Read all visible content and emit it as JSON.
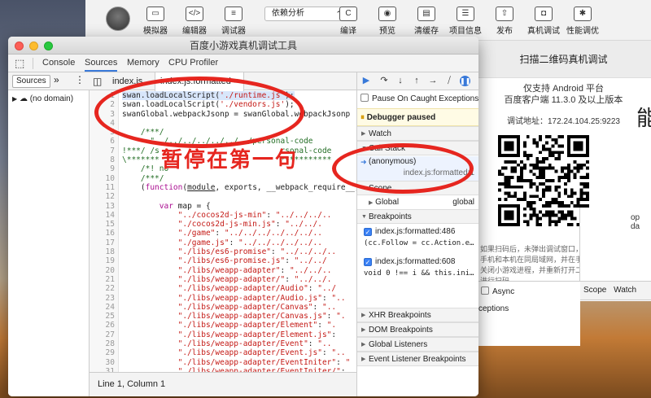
{
  "ide": {
    "toolbar": [
      {
        "label": "模拟器",
        "icon": "▭"
      },
      {
        "label": "编辑器",
        "icon": "</>"
      },
      {
        "label": "调试器",
        "icon": "≡"
      },
      {
        "label": "编译",
        "icon": "C"
      },
      {
        "label": "预览",
        "icon": "◉"
      },
      {
        "label": "清缓存",
        "icon": "▤"
      },
      {
        "label": "项目信息",
        "icon": "☰"
      },
      {
        "label": "发布",
        "icon": "⇧"
      },
      {
        "label": "真机调试",
        "icon": "◘"
      },
      {
        "label": "性能调优",
        "icon": "✱"
      }
    ],
    "mode_select": "依赖分析"
  },
  "qr_panel": {
    "title": "扫描二维码真机调试",
    "support_line1": "仅支持 Android 平台",
    "support_line2": "百度客户端 11.3.0 及以上版本",
    "address": "调试地址：172.24.104.25:9223",
    "note": "如果扫码后，未弹出调试窗口，请保证手机和本机在同局域网，并在手机上，关闭小游戏进程，并重新打开二维码，进行扫码。",
    "side_text": "能"
  },
  "background": {
    "op_text": "op da",
    "async_label": "Async",
    "exceptions_label": "xceptions",
    "scope_tab": "Scope",
    "watch_tab": "Watch"
  },
  "devtools": {
    "title": "百度小游戏真机调试工具",
    "panel_tabs": [
      "Console",
      "Sources",
      "Memory",
      "CPU Profiler"
    ],
    "active_panel": "Sources",
    "navigator": {
      "tab": "Sources",
      "tree_item": "(no domain)"
    },
    "editor": {
      "tabs": [
        {
          "label": "index.js"
        },
        {
          "label": "index.js:formatted",
          "close": "×"
        }
      ],
      "status": "Line 1, Column 1"
    },
    "debugger": {
      "pause_on_caught": "Pause On Caught Exceptions",
      "paused_banner": "Debugger paused",
      "sections": {
        "watch": "Watch",
        "call_stack": "Call Stack",
        "scope": "Scope",
        "breakpoints": "Breakpoints",
        "xhr": "XHR Breakpoints",
        "dom": "DOM Breakpoints",
        "global_listeners": "Global Listeners",
        "event_listeners": "Event Listener Breakpoints"
      },
      "call_frame": {
        "name": "(anonymous)",
        "location": "index.js:formatted:1"
      },
      "scope_row": {
        "name": "Global",
        "value": "global"
      },
      "breakpoints": [
        {
          "location": "index.js:formatted:486",
          "code": "(cc.Follow = cc.Action.e…"
        },
        {
          "location": "index.js:formatted:608",
          "code": "void 0 !== i && this.ini…"
        }
      ]
    }
  },
  "annotation": {
    "text": "暂停在第一句"
  }
}
